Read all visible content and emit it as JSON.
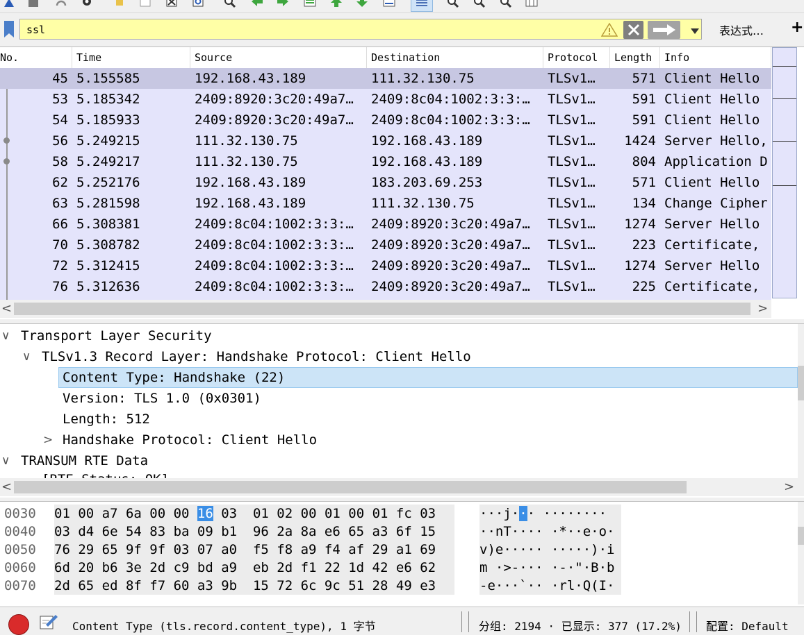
{
  "toolbar": {
    "icons": [
      "capture-options-icon",
      "stop-capture-icon",
      "restart-capture-icon",
      "capture-settings-icon",
      "open-file-icon",
      "save-file-icon",
      "close-file-icon",
      "reload-icon",
      "find-packet-icon",
      "go-back-icon",
      "go-forward-icon",
      "go-to-packet-icon",
      "go-first-icon",
      "go-last-icon",
      "auto-scroll-icon",
      "colorize-icon",
      "zoom-in-icon",
      "zoom-out-icon",
      "normal-size-icon",
      "resize-columns-icon"
    ]
  },
  "filter": {
    "value": "ssl",
    "expression_label": "表达式…",
    "plus_label": "+"
  },
  "packet_list": {
    "columns": [
      "No.",
      "Time",
      "Source",
      "Destination",
      "Protocol",
      "Length",
      "Info"
    ],
    "rows": [
      {
        "no": "45",
        "time": "5.155585",
        "src": "192.168.43.189",
        "dst": "111.32.130.75",
        "proto": "TLSv1…",
        "len": "571",
        "info": "Client Hello"
      },
      {
        "no": "53",
        "time": "5.185342",
        "src": "2409:8920:3c20:49a7…",
        "dst": "2409:8c04:1002:3:3:…",
        "proto": "TLSv1…",
        "len": "591",
        "info": "Client Hello"
      },
      {
        "no": "54",
        "time": "5.185933",
        "src": "2409:8920:3c20:49a7…",
        "dst": "2409:8c04:1002:3:3:…",
        "proto": "TLSv1…",
        "len": "591",
        "info": "Client Hello"
      },
      {
        "no": "56",
        "time": "5.249215",
        "src": "111.32.130.75",
        "dst": "192.168.43.189",
        "proto": "TLSv1…",
        "len": "1424",
        "info": "Server Hello,"
      },
      {
        "no": "58",
        "time": "5.249217",
        "src": "111.32.130.75",
        "dst": "192.168.43.189",
        "proto": "TLSv1…",
        "len": "804",
        "info": "Application D"
      },
      {
        "no": "62",
        "time": "5.252176",
        "src": "192.168.43.189",
        "dst": "183.203.69.253",
        "proto": "TLSv1…",
        "len": "571",
        "info": "Client Hello"
      },
      {
        "no": "63",
        "time": "5.281598",
        "src": "192.168.43.189",
        "dst": "111.32.130.75",
        "proto": "TLSv1…",
        "len": "134",
        "info": "Change Cipher"
      },
      {
        "no": "66",
        "time": "5.308381",
        "src": "2409:8c04:1002:3:3:…",
        "dst": "2409:8920:3c20:49a7…",
        "proto": "TLSv1…",
        "len": "1274",
        "info": "Server Hello"
      },
      {
        "no": "70",
        "time": "5.308782",
        "src": "2409:8c04:1002:3:3:…",
        "dst": "2409:8920:3c20:49a7…",
        "proto": "TLSv1…",
        "len": "223",
        "info": "Certificate,"
      },
      {
        "no": "72",
        "time": "5.312415",
        "src": "2409:8c04:1002:3:3:…",
        "dst": "2409:8920:3c20:49a7…",
        "proto": "TLSv1…",
        "len": "1274",
        "info": "Server Hello"
      },
      {
        "no": "76",
        "time": "5.312636",
        "src": "2409:8c04:1002:3:3:…",
        "dst": "2409:8920:3c20:49a7…",
        "proto": "TLSv1…",
        "len": "225",
        "info": "Certificate,"
      }
    ]
  },
  "details": {
    "items": [
      {
        "text": "Transport Layer Security",
        "expander": "∨"
      },
      {
        "text": "TLSv1.3 Record Layer: Handshake Protocol: Client Hello",
        "expander": "∨"
      },
      {
        "text": "Content Type: Handshake (22)",
        "expander": ""
      },
      {
        "text": "Version: TLS 1.0 (0x0301)",
        "expander": ""
      },
      {
        "text": "Length: 512",
        "expander": ""
      },
      {
        "text": "Handshake Protocol: Client Hello",
        "expander": ">"
      },
      {
        "text": "TRANSUM RTE Data",
        "expander": "∨"
      },
      {
        "text": "[RTE Status: OK]",
        "expander": ""
      }
    ]
  },
  "bytes": {
    "rows": [
      {
        "offset": "0030",
        "hex_pre": "01 00 a7 6a 00 00 ",
        "hex_hl": "16",
        "hex_post": " 03  01 02 00 01 00 01 fc 03",
        "ascii_pre": "···j·",
        "ascii_hl": "·",
        "ascii_post": "· ········"
      },
      {
        "offset": "0040",
        "hex_pre": "03 d4 6e 54 83 ba 09 b1  96 2a 8a e6 65 a3 6f 15",
        "hex_hl": "",
        "hex_post": "",
        "ascii_pre": "··nT···· ·*··e·o·",
        "ascii_hl": "",
        "ascii_post": ""
      },
      {
        "offset": "0050",
        "hex_pre": "76 29 65 9f 9f 03 07 a0  f5 f8 a9 f4 af 29 a1 69",
        "hex_hl": "",
        "hex_post": "",
        "ascii_pre": "v)e····· ·····)·i",
        "ascii_hl": "",
        "ascii_post": ""
      },
      {
        "offset": "0060",
        "hex_pre": "6d 20 b6 3e 2d c9 bd a9  eb 2d f1 22 1d 42 e6 62",
        "hex_hl": "",
        "hex_post": "",
        "ascii_pre": "m ·>-··· ·-·\"·B·b",
        "ascii_hl": "",
        "ascii_post": ""
      },
      {
        "offset": "0070",
        "hex_pre": "2d 65 ed 8f f7 60 a3 9b  15 72 6c 9c 51 28 49 e3",
        "hex_hl": "",
        "hex_post": "",
        "ascii_pre": "-e···`·· ·rl·Q(I·",
        "ascii_hl": "",
        "ascii_post": ""
      }
    ]
  },
  "status": {
    "field": "Content Type (tls.record.content_type), 1 字节",
    "packets": "分组: 2194 · 已显示: 377 (17.2%)",
    "profile": "配置: Default"
  },
  "colors": {
    "row_bg": "#e4e4fb",
    "row_selected": "#c7c7e2",
    "filter_bg": "#ffffa6",
    "detail_selected": "#cce4f7",
    "byte_highlight": "#3a8ee6"
  }
}
